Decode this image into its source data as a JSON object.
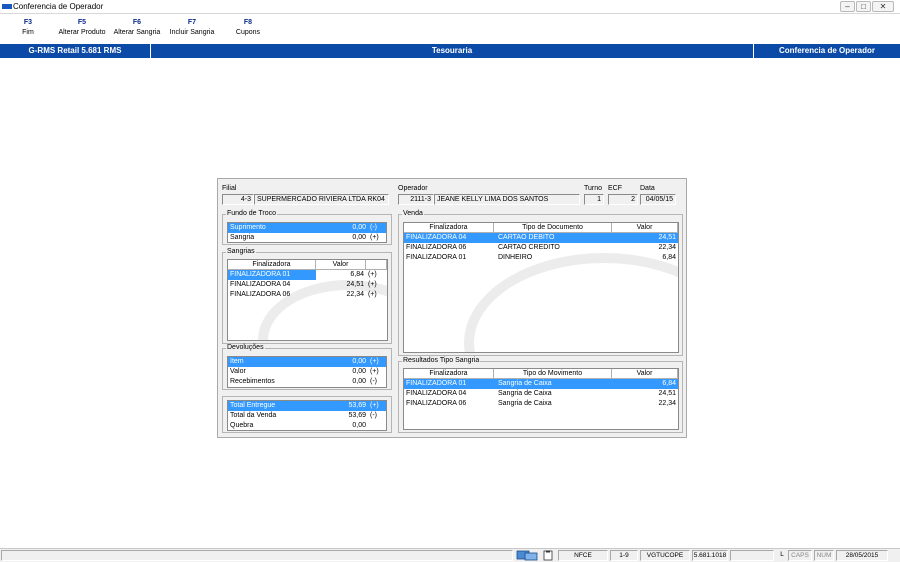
{
  "window": {
    "title": "Conferencia de Operador"
  },
  "fkeys": [
    {
      "key": "F3",
      "label": "Fim"
    },
    {
      "key": "F5",
      "label": "Alterar Produto"
    },
    {
      "key": "F6",
      "label": "Alterar Sangria"
    },
    {
      "key": "F7",
      "label": "Incluir Sangria"
    },
    {
      "key": "F8",
      "label": "Cupons"
    }
  ],
  "header": {
    "left": "G-RMS Retail 5.681 RMS",
    "center": "Tesouraria",
    "right": "Conferencia de Operador"
  },
  "dialog": {
    "filial_label": "Filial",
    "filial_code": "4-3",
    "filial_name": "SUPERMERCADO RIVIERA LTDA RK04",
    "operador_label": "Operador",
    "operador_code": "2111-3",
    "operador_name": "JEANE KELLY LIMA DOS SANTOS",
    "turno_label": "Turno",
    "turno": "1",
    "ecf_label": "ECF",
    "ecf": "2",
    "data_label": "Data",
    "data": "04/05/15",
    "fundo": {
      "title": "Fundo de Troco",
      "rows": [
        {
          "label": "Suprimento",
          "value": "0,00",
          "sign": "(-)"
        },
        {
          "label": "Sangria",
          "value": "0,00",
          "sign": "(+)"
        }
      ]
    },
    "sangrias": {
      "title": "Sangrias",
      "headers": [
        "Finalizadora",
        "Valor"
      ],
      "rows": [
        {
          "name": "FINALIZADORA 01",
          "value": "6,84",
          "sign": "(+)"
        },
        {
          "name": "FINALIZADORA 04",
          "value": "24,51",
          "sign": "(+)"
        },
        {
          "name": "FINALIZADORA 06",
          "value": "22,34",
          "sign": "(+)"
        }
      ]
    },
    "devolucoes": {
      "title": "Devoluções",
      "rows": [
        {
          "label": "Item",
          "value": "0,00",
          "sign": "(+)"
        },
        {
          "label": "Valor",
          "value": "0,00",
          "sign": "(+)"
        },
        {
          "label": "Recebimentos",
          "value": "0,00",
          "sign": "(-)"
        }
      ]
    },
    "totais": {
      "rows": [
        {
          "label": "Total Entregue",
          "value": "53,69",
          "sign": "(+)"
        },
        {
          "label": "Total da Venda",
          "value": "53,69",
          "sign": "(-)"
        },
        {
          "label": "Quebra",
          "value": "0,00",
          "sign": ""
        }
      ]
    },
    "venda": {
      "title": "Venda",
      "headers": [
        "Finalizadora",
        "Tipo de Documento",
        "Valor"
      ],
      "rows": [
        {
          "fin": "FINALIZADORA 04",
          "tipo": "CARTAO DEBITO",
          "valor": "24,51"
        },
        {
          "fin": "FINALIZADORA 06",
          "tipo": "CARTAO CREDITO",
          "valor": "22,34"
        },
        {
          "fin": "FINALIZADORA 01",
          "tipo": "DINHEIRO",
          "valor": "6,84"
        }
      ]
    },
    "resultados": {
      "title": "Resultados Tipo Sangria",
      "headers": [
        "Finalizadora",
        "Tipo do Movimento",
        "Valor"
      ],
      "rows": [
        {
          "fin": "FINALIZADORA 01",
          "tipo": "Sangria de Caixa",
          "valor": "6,84"
        },
        {
          "fin": "FINALIZADORA 04",
          "tipo": "Sangria de Caixa",
          "valor": "24,51"
        },
        {
          "fin": "FINALIZADORA 06",
          "tipo": "Sangria de Caixa",
          "valor": "22,34"
        }
      ]
    }
  },
  "statusbar": {
    "mode": "NFCE",
    "pdv": "1-9",
    "user": "VGTUCOPE",
    "version": "5.681.1018",
    "l": "L",
    "caps": "CAPS",
    "num": "NUM",
    "date": "28/05/2015"
  }
}
